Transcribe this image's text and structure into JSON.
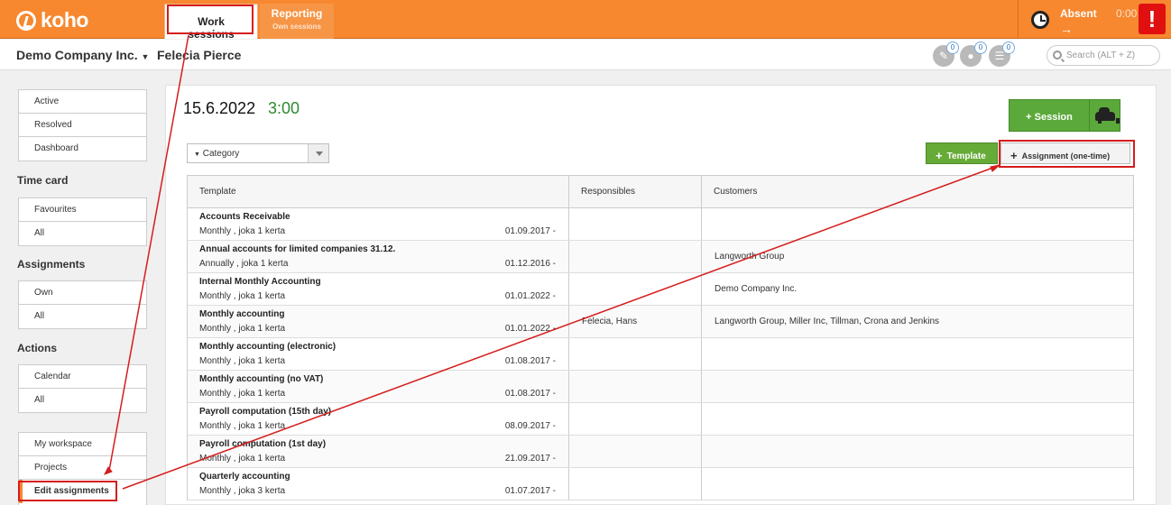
{
  "topbar": {
    "logo": "koho",
    "nav": [
      {
        "label": "Work sessions"
      },
      {
        "label": "Reporting",
        "sub": "Own sessions"
      }
    ],
    "absent": {
      "label": "Absent",
      "time": "0:00",
      "arrow": "→"
    },
    "alert": "!"
  },
  "subheader": {
    "company": "Demo Company Inc.",
    "person": "Felecia Pierce",
    "badges": [
      "0",
      "0",
      "0"
    ],
    "search_placeholder": "Search (ALT + Z)"
  },
  "sidebar": {
    "top_items": [
      "Active",
      "Resolved",
      "Dashboard"
    ],
    "time_card_title": "Time card",
    "time_card_items": [
      "Favourites",
      "All"
    ],
    "assignments_title": "Assignments",
    "assignments_items": [
      "Own",
      "All"
    ],
    "actions_title": "Actions",
    "actions_items": [
      "Calendar",
      "All"
    ],
    "bottom_items": [
      "My workspace",
      "Projects",
      "Edit assignments"
    ]
  },
  "main": {
    "date": "15.6.2022",
    "hours": "3:00",
    "session_button": "+ Session",
    "category_placeholder": "Category",
    "template_button": "Template",
    "assignment_button": "Assignment (one-time)",
    "columns": [
      "Template",
      "Responsibles",
      "Customers"
    ],
    "rows": [
      {
        "name": "Accounts Receivable",
        "freq": "Monthly , joka 1 kerta",
        "date": "01.09.2017 -",
        "responsibles": "",
        "customers": ""
      },
      {
        "name": "Annual accounts for limited companies 31.12.",
        "freq": "Annually , joka 1 kerta",
        "date": "01.12.2016 -",
        "responsibles": "",
        "customers": "Langworth Group"
      },
      {
        "name": "Internal Monthly Accounting",
        "freq": "Monthly , joka 1 kerta",
        "date": "01.01.2022 -",
        "responsibles": "",
        "customers": "Demo Company Inc."
      },
      {
        "name": "Monthly accounting",
        "freq": "Monthly , joka 1 kerta",
        "date": "01.01.2022 -",
        "responsibles": "Felecia, Hans",
        "customers": "Langworth Group, Miller Inc, Tillman, Crona and Jenkins"
      },
      {
        "name": "Monthly accounting (electronic)",
        "freq": "Monthly , joka 1 kerta",
        "date": "01.08.2017 -",
        "responsibles": "",
        "customers": ""
      },
      {
        "name": "Monthly accounting (no VAT)",
        "freq": "Monthly , joka 1 kerta",
        "date": "01.08.2017 -",
        "responsibles": "",
        "customers": ""
      },
      {
        "name": "Payroll computation (15th day)",
        "freq": "Monthly , joka 1 kerta",
        "date": "08.09.2017 -",
        "responsibles": "",
        "customers": ""
      },
      {
        "name": "Payroll computation (1st day)",
        "freq": "Monthly , joka 1 kerta",
        "date": "21.09.2017 -",
        "responsibles": "",
        "customers": ""
      },
      {
        "name": "Quarterly accounting",
        "freq": "Monthly , joka 3 kerta",
        "date": "01.07.2017 -",
        "responsibles": "",
        "customers": ""
      }
    ]
  },
  "colors": {
    "brand_orange": "#f7882f",
    "green": "#5ba93a",
    "highlight_red": "#d51d1d"
  }
}
